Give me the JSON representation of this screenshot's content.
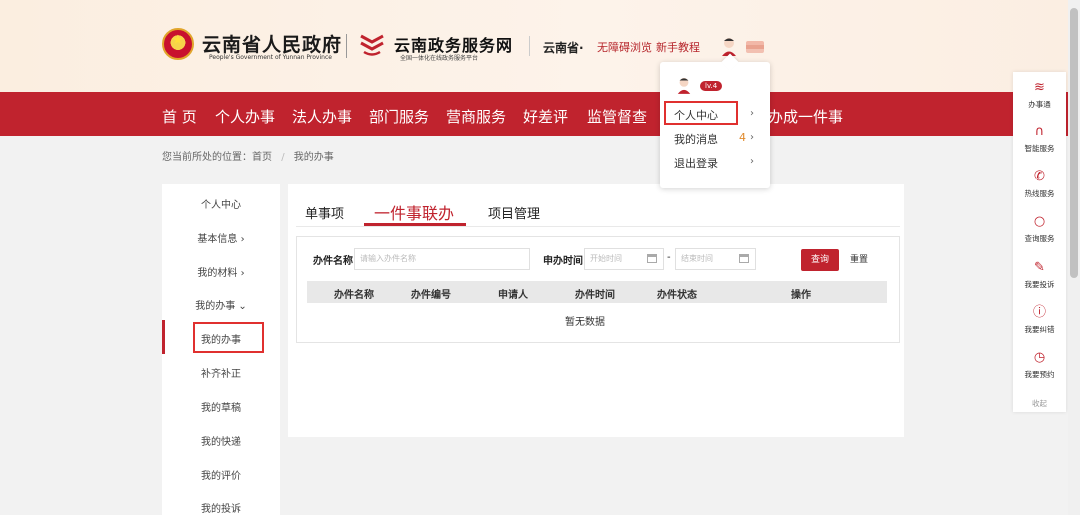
{
  "header": {
    "gov_title": "云南省人民政府",
    "gov_subtitle": "People's Government of Yunnan Province",
    "service_title": "云南政务服务网",
    "service_subtitle": "全国一体化在线政务服务平台",
    "region": "云南省·",
    "accessible": "无障碍浏览",
    "tutorial": "新手教程"
  },
  "nav": {
    "items": [
      "首 页",
      "个人办事",
      "法人办事",
      "部门服务",
      "营商服务",
      "好差评",
      "监管督查",
      "办成一件事"
    ]
  },
  "breadcrumb": {
    "prefix": "您当前所处的位置：首页",
    "separator": "/",
    "current": "我的办事"
  },
  "left_menu": {
    "items": [
      "个人中心",
      "基本信息 ›",
      "我的材料 ›",
      "我的办事 ⌄",
      "我的办事",
      "补齐补正",
      "我的草稿",
      "我的快递",
      "我的评价",
      "我的投诉"
    ]
  },
  "main": {
    "tabs": [
      "单事项",
      "一件事联办",
      "项目管理"
    ],
    "active_tab": "一件事联办",
    "filter": {
      "name_label": "办件名称",
      "name_placeholder": "请输入办件名称",
      "time_label": "申办时间",
      "start_placeholder": "开始时间",
      "end_placeholder": "结束时间",
      "range_sep": "-",
      "query_button": "查询",
      "reset_button": "重置"
    },
    "table": {
      "columns": [
        "办件名称",
        "办件编号",
        "申请人",
        "办件时间",
        "办件状态",
        "操作"
      ],
      "empty_text": "暂无数据"
    }
  },
  "dropdown": {
    "level": "lv.4",
    "items": [
      {
        "label": "个人中心",
        "arrow": "›"
      },
      {
        "label": "我的消息",
        "count": "4",
        "arrow": "›"
      },
      {
        "label": "退出登录",
        "arrow": "›"
      }
    ]
  },
  "right_bar": {
    "items": [
      {
        "icon": "service-logo-icon",
        "label": "办事通"
      },
      {
        "icon": "headset-icon",
        "label": "智能服务"
      },
      {
        "icon": "phone-icon",
        "label": "热线服务"
      },
      {
        "icon": "search-icon",
        "label": "查询服务"
      },
      {
        "icon": "edit-icon",
        "label": "我要投诉"
      },
      {
        "icon": "alert-icon",
        "label": "我要纠错"
      },
      {
        "icon": "clock-icon",
        "label": "我要预约"
      }
    ],
    "collapse": "收起"
  },
  "colors": {
    "brand_red": "#c0232e",
    "highlight_red": "#e0302f"
  }
}
